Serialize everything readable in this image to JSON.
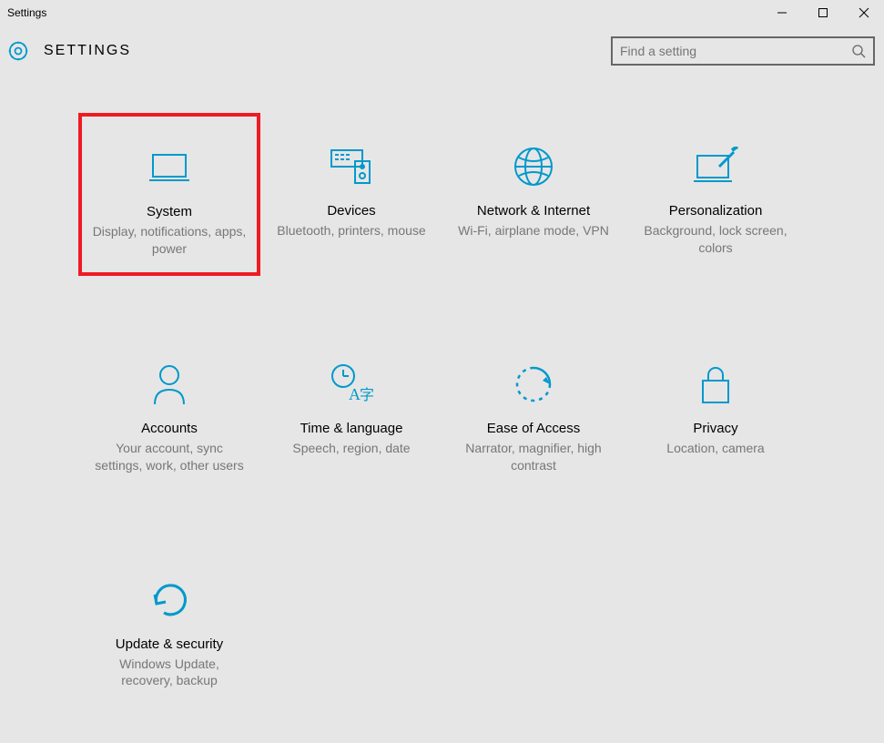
{
  "window": {
    "title": "Settings"
  },
  "header": {
    "page_title": "SETTINGS"
  },
  "search": {
    "placeholder": "Find a setting"
  },
  "accent": "#0099cc",
  "tiles": [
    {
      "title": "System",
      "desc": "Display, notifications, apps, power",
      "highlight": true
    },
    {
      "title": "Devices",
      "desc": "Bluetooth, printers, mouse",
      "highlight": false
    },
    {
      "title": "Network & Internet",
      "desc": "Wi-Fi, airplane mode, VPN",
      "highlight": false
    },
    {
      "title": "Personalization",
      "desc": "Background, lock screen, colors",
      "highlight": false
    },
    {
      "title": "Accounts",
      "desc": "Your account, sync settings, work, other users",
      "highlight": false
    },
    {
      "title": "Time & language",
      "desc": "Speech, region, date",
      "highlight": false
    },
    {
      "title": "Ease of Access",
      "desc": "Narrator, magnifier, high contrast",
      "highlight": false
    },
    {
      "title": "Privacy",
      "desc": "Location, camera",
      "highlight": false
    },
    {
      "title": "Update & security",
      "desc": "Windows Update, recovery, backup",
      "highlight": false
    }
  ]
}
